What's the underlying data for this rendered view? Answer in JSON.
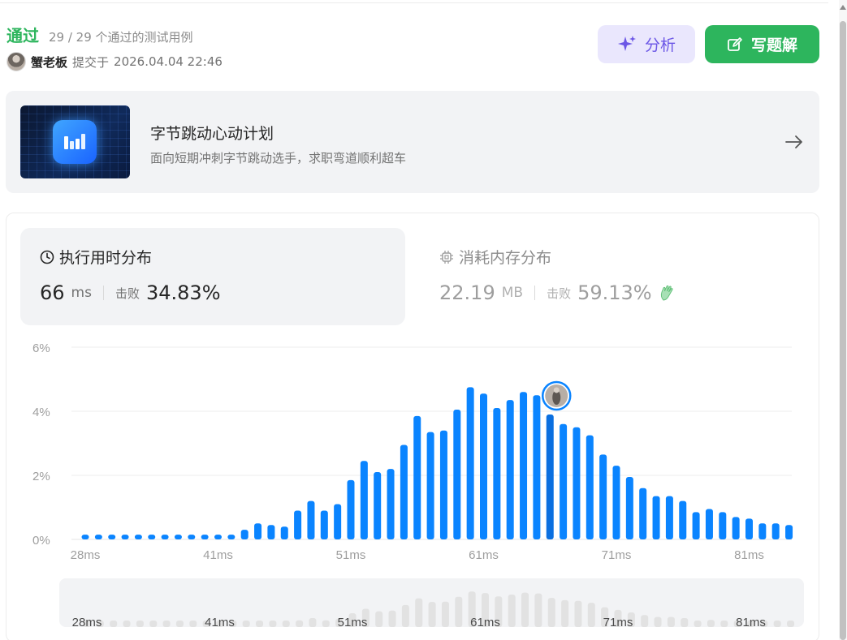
{
  "header": {
    "status": "通过",
    "status_detail": "29 / 29 个通过的测试用例",
    "author": "蟹老板",
    "submitted_prefix": "提交于",
    "submitted_time": "2026.04.04 22:46",
    "analyze_label": "分析",
    "solution_label": "写题解"
  },
  "promo": {
    "title": "字节跳动心动计划",
    "subtitle": "面向短期冲刺字节跳动选手，求职弯道顺利超车"
  },
  "runtime": {
    "title": "执行用时分布",
    "value": "66",
    "unit": "ms",
    "beats_label": "击败",
    "beats_value": "34.83%"
  },
  "memory": {
    "title": "消耗内存分布",
    "value": "22.19",
    "unit": "MB",
    "beats_label": "击败",
    "beats_value": "59.13%"
  },
  "colors": {
    "accent_green": "#2db55d",
    "bar_blue": "#0a84ff",
    "analyze_purple": "#6b56e6"
  },
  "chart_data": {
    "type": "bar",
    "ylabel": "",
    "xlabel": "",
    "yticks": [
      "6%",
      "4%",
      "2%",
      "0%"
    ],
    "ylim": [
      0,
      6
    ],
    "xtick_labels": [
      "28ms",
      "41ms",
      "51ms",
      "61ms",
      "71ms",
      "81ms"
    ],
    "xtick_indices": [
      0,
      10,
      20,
      30,
      40,
      50
    ],
    "grid": true,
    "highlight_index": 35,
    "values": [
      0.15,
      0.15,
      0.15,
      0.15,
      0.15,
      0.15,
      0.15,
      0.15,
      0.15,
      0.15,
      0.15,
      0.15,
      0.3,
      0.5,
      0.45,
      0.4,
      0.9,
      1.2,
      0.9,
      1.1,
      1.85,
      2.45,
      2.1,
      2.2,
      2.95,
      3.85,
      3.35,
      3.4,
      4.05,
      4.75,
      4.55,
      4.1,
      4.35,
      4.6,
      4.5,
      3.9,
      3.6,
      3.5,
      3.25,
      2.65,
      2.3,
      1.95,
      1.6,
      1.35,
      1.35,
      1.2,
      0.85,
      0.95,
      0.85,
      0.7,
      0.65,
      0.5,
      0.5,
      0.45
    ]
  }
}
